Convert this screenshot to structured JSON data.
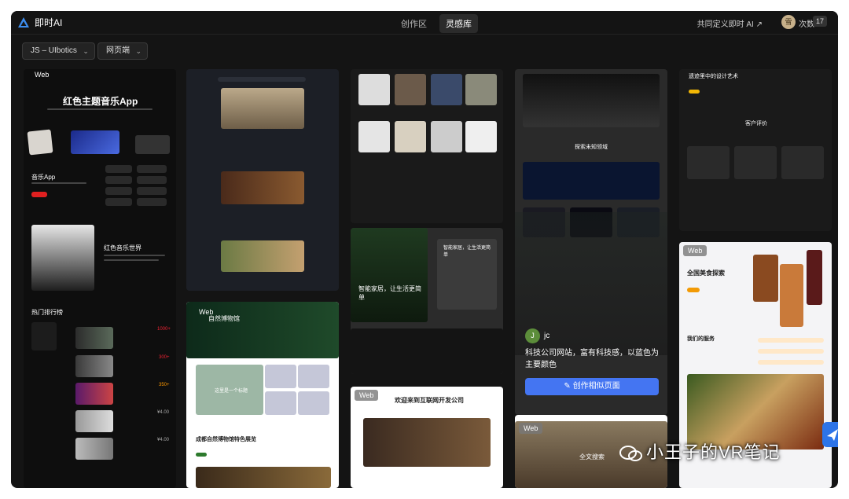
{
  "app": {
    "name": "即时AI",
    "tabs": [
      {
        "label": "创作区",
        "active": false
      },
      {
        "label": "灵感库",
        "active": true
      }
    ],
    "co_define": "共同定义即时 AI ↗",
    "avatar_text": "雪",
    "credits_label": "次数",
    "credits_value": "17"
  },
  "filters": {
    "framework": "JS – UIbotics",
    "platform": "网页端"
  },
  "cards": {
    "music": {
      "badge": "Web",
      "title": "红色主题音乐App",
      "app_title": "音乐App",
      "world_title": "红色音乐世界",
      "chart_title": "热门排行榜",
      "chart_values": [
        "1000+",
        "300+",
        "350+",
        "¥4.00",
        "¥4.00"
      ]
    },
    "museum": {
      "badge": "Web",
      "title": "自然博物馆",
      "feature": "这里是一个标题",
      "section": "成都自然博物馆特色展览"
    },
    "home": {
      "title": "智能家居，让生活更简单",
      "form_title": "智能家居，让生活更简单"
    },
    "internet": {
      "badge": "Web",
      "title": "欢迎来到互联网开发公司"
    },
    "tech": {
      "section": "探索未知领域",
      "user": "jc",
      "desc": "科技公司网站，富有科技感，以蓝色为主要颜色",
      "button": "创作相似页面",
      "button_icon": "magic-wand-icon"
    },
    "travel": {
      "badge": "Web",
      "title": "全文搜索"
    },
    "design": {
      "title": "遗迹里中的设计艺术",
      "reviews": "客户评价"
    },
    "food": {
      "badge": "Web",
      "title": "全国美食探索",
      "services": "我们的服务"
    }
  },
  "watermark": "小王子的VR笔记"
}
